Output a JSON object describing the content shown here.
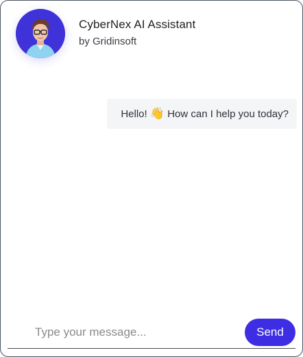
{
  "header": {
    "title": "CyberNex AI Assistant",
    "subtitle": "by Gridinsoft",
    "avatar_icon": "robot-avatar-icon"
  },
  "messages": [
    {
      "from": "assistant",
      "text_before": "Hello! ",
      "emoji": "👋",
      "text_after": " How can I help you today?"
    }
  ],
  "composer": {
    "placeholder": "Type your message...",
    "value": "",
    "send_label": "Send"
  },
  "colors": {
    "accent": "#3d2ee3",
    "avatar_bg": "#3f32d8",
    "bubble_bg": "#f4f5f7",
    "border": "#4a5565"
  }
}
